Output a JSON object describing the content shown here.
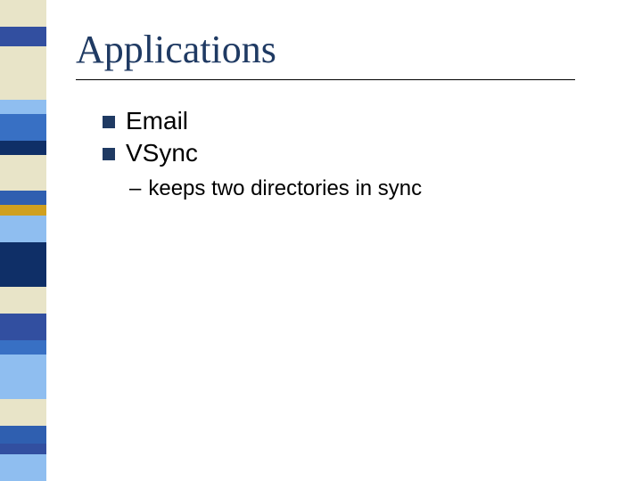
{
  "title": "Applications",
  "bullets": {
    "item1": "Email",
    "item2": "VSync",
    "sub1": "keeps two directories in sync"
  },
  "sidebar_colors": [
    "#e8e4c8",
    "#324fa0",
    "#e8e4c8",
    "#8fbef0",
    "#3870c4",
    "#0f2f67",
    "#e8e4c8",
    "#2f5fb0",
    "#d0a020",
    "#8fbef0",
    "#0f2f67",
    "#e8e4c8",
    "#324fa0",
    "#3870c4",
    "#8fbef0",
    "#e8e4c8",
    "#2f5fb0",
    "#324fa0",
    "#8fbef0"
  ]
}
